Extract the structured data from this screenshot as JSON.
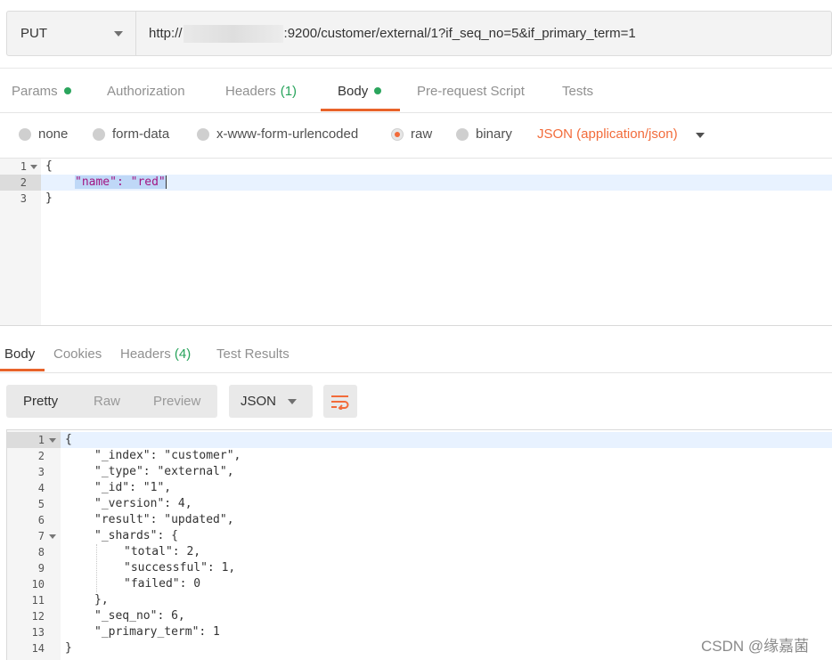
{
  "request": {
    "method": "PUT",
    "url_prefix": "http://",
    "url_suffix": ":9200/customer/external/1?if_seq_no=5&if_primary_term=1"
  },
  "request_tabs": [
    {
      "label": "Params",
      "dot": true
    },
    {
      "label": "Authorization"
    },
    {
      "label": "Headers",
      "count": "(1)"
    },
    {
      "label": "Body",
      "dot": true,
      "active": true
    },
    {
      "label": "Pre-request Script"
    },
    {
      "label": "Tests"
    }
  ],
  "body_types": {
    "options": [
      "none",
      "form-data",
      "x-www-form-urlencoded",
      "raw",
      "binary"
    ],
    "selected": "raw",
    "content_type": "JSON (application/json)"
  },
  "request_body": {
    "line_numbers": [
      "1",
      "2",
      "3"
    ],
    "lines": [
      "{",
      "\"name\": \"red\"",
      "}"
    ]
  },
  "response_tabs": [
    {
      "label": "Body",
      "active": true
    },
    {
      "label": "Cookies"
    },
    {
      "label": "Headers",
      "count": "(4)"
    },
    {
      "label": "Test Results"
    }
  ],
  "response_toolbar": {
    "views": [
      "Pretty",
      "Raw",
      "Preview"
    ],
    "active_view": "Pretty",
    "format": "JSON",
    "wrap_icon": "wrap-lines-icon"
  },
  "response_body": {
    "line_numbers": [
      "1",
      "2",
      "3",
      "4",
      "5",
      "6",
      "7",
      "8",
      "9",
      "10",
      "11",
      "12",
      "13",
      "14"
    ],
    "lines": [
      "{",
      "\"_index\": \"customer\",",
      "\"_type\": \"external\",",
      "\"_id\": \"1\",",
      "\"_version\": 4,",
      "\"result\": \"updated\",",
      "\"_shards\": {",
      "\"total\": 2,",
      "\"successful\": 1,",
      "\"failed\": 0",
      "},",
      "\"_seq_no\": 6,",
      "\"_primary_term\": 1",
      "}"
    ]
  },
  "watermark": "CSDN @缘嘉菌",
  "colors": {
    "accent": "#e8632a",
    "dot_green": "#2ba55d",
    "json_key": "#a21582",
    "json_value": "#1a1aa6",
    "content_type": "#f26b3a"
  }
}
